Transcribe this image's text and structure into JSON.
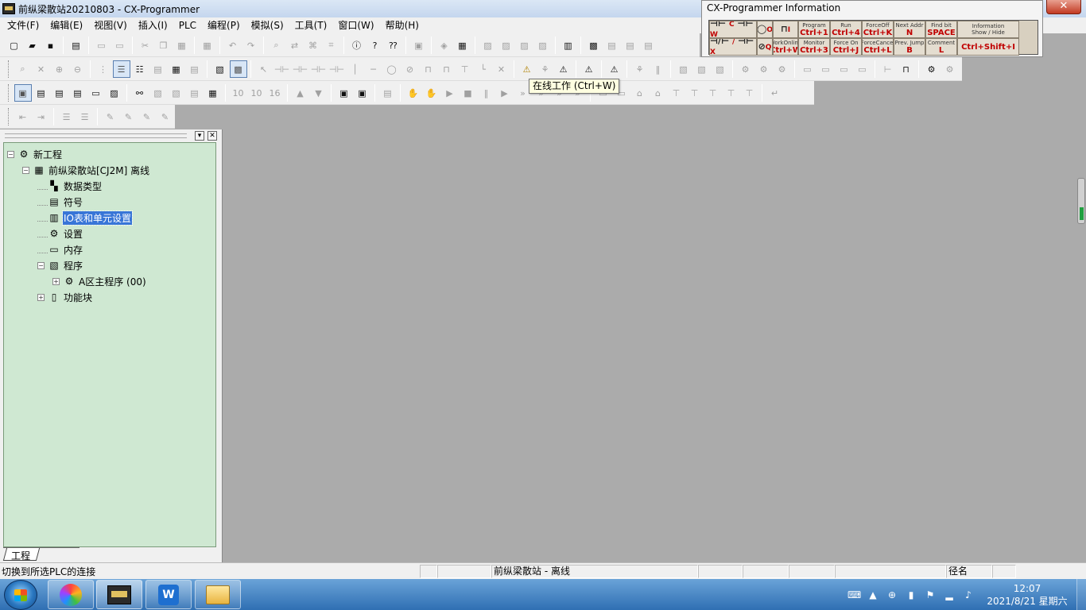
{
  "window": {
    "title": "前纵梁散站20210803 - CX-Programmer",
    "close_label": "✕"
  },
  "menu": {
    "items": [
      {
        "label": "文件(F)"
      },
      {
        "label": "编辑(E)"
      },
      {
        "label": "视图(V)"
      },
      {
        "label": "插入(I)"
      },
      {
        "label": "PLC"
      },
      {
        "label": "编程(P)"
      },
      {
        "label": "模拟(S)"
      },
      {
        "label": "工具(T)"
      },
      {
        "label": "窗口(W)"
      },
      {
        "label": "帮助(H)"
      }
    ]
  },
  "tooltip": {
    "text": "在线工作 (Ctrl+W)"
  },
  "info_popup": {
    "title": "CX-Programmer Information",
    "cells": {
      "c": {
        "key": "C"
      },
      "w": {
        "key": "W"
      },
      "o": {
        "key": "O"
      },
      "i": {
        "key": "I"
      },
      "slash": {
        "key": "/"
      },
      "x": {
        "key": "X"
      },
      "q": {
        "key": "Q"
      },
      "program": {
        "label": "Program",
        "key": "Ctrl+1"
      },
      "run": {
        "label": "Run",
        "key": "Ctrl+4"
      },
      "force_off": {
        "label": "ForceOff",
        "key": "Ctrl+K"
      },
      "next_addr": {
        "label": "Next Addr",
        "key": "N"
      },
      "find_bit": {
        "label": "Find bit",
        "key": "SPACE"
      },
      "info": {
        "label": "Information",
        "label2": "Show / Hide"
      },
      "work_online": {
        "label": "WorkOnline",
        "key": "Ctrl+W"
      },
      "monitor": {
        "label": "Monitor",
        "key": "Ctrl+3"
      },
      "force_on": {
        "label": "Force On",
        "key": "Ctrl+J"
      },
      "force_cancel": {
        "label": "ForceCancel",
        "key": "Ctrl+L"
      },
      "prev_jump": {
        "label": "Prev. Jump",
        "key": "B"
      },
      "comment": {
        "label": "Comment",
        "key": "L"
      },
      "info_key": {
        "key": "Ctrl+Shift+I"
      }
    }
  },
  "project_tree": {
    "nodes": {
      "project": {
        "label": "新工程"
      },
      "plc": {
        "label": "前纵梁散站[CJ2M] 离线"
      },
      "data_types": {
        "label": "数据类型"
      },
      "symbols": {
        "label": "符号"
      },
      "io_table": {
        "label": "IO表和单元设置"
      },
      "settings": {
        "label": "设置"
      },
      "memory": {
        "label": "内存"
      },
      "programs": {
        "label": "程序"
      },
      "main_program": {
        "label": "A区主程序 (00)"
      },
      "function_blocks": {
        "label": "功能块"
      }
    },
    "tab_label": "工程"
  },
  "statusbar": {
    "message": "切换到所选PLC的连接",
    "plc_status": "前纵梁散站 - 离线",
    "mode": "径名"
  },
  "taskbar": {
    "clock_time": "12:07",
    "clock_date": "2021/8/21 星期六"
  },
  "colors": {
    "tree_background": "#cfe8d2",
    "workspace": "#ababab",
    "selection": "#3875d7",
    "taskbar": "#2f6fb3"
  }
}
